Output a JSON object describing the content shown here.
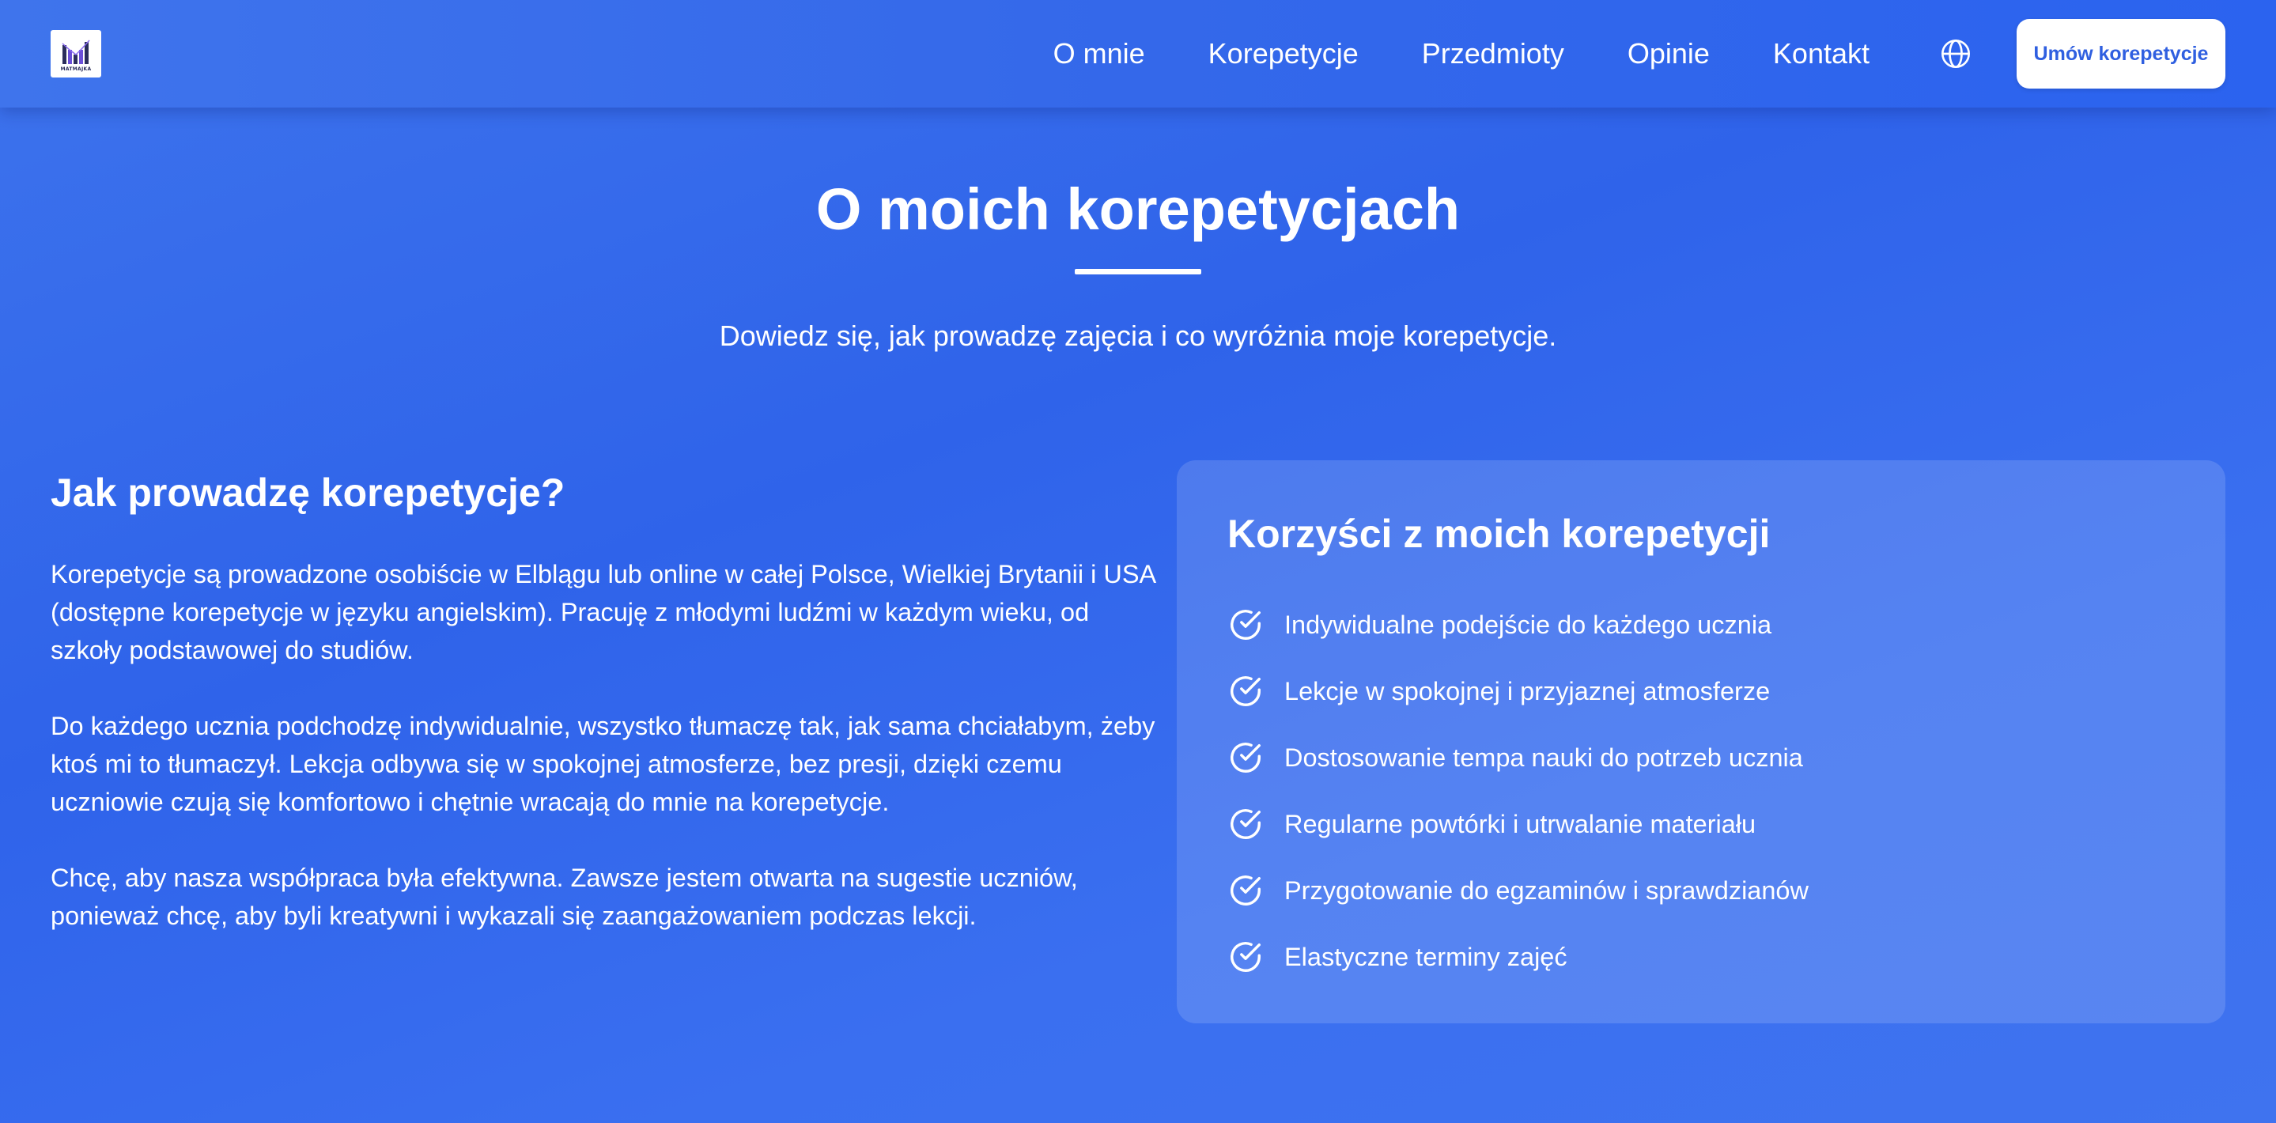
{
  "header": {
    "logo_text": "MATMAJKA",
    "nav": [
      {
        "label": "O mnie"
      },
      {
        "label": "Korepetycje"
      },
      {
        "label": "Przedmioty"
      },
      {
        "label": "Opinie"
      },
      {
        "label": "Kontakt"
      }
    ],
    "language_icon": "globe-icon",
    "cta_label": "Umów korepetycje"
  },
  "hero": {
    "title": "O moich korepetycjach",
    "subtitle": "Dowiedz się, jak prowadzę zajęcia i co wyróżnia moje korepetycje."
  },
  "how": {
    "heading": "Jak prowadzę korepetycje?",
    "paragraphs": [
      "Korepetycje są prowadzone osobiście w Elblągu lub online w całej Polsce, Wielkiej Brytanii i USA (dostępne korepetycje w języku angielskim). Pracuję z młodymi ludźmi w każdym wieku, od szkoły podstawowej do studiów.",
      "Do każdego ucznia podchodzę indywidualnie, wszystko tłumaczę tak, jak sama chciałabym, żeby ktoś mi to tłumaczył. Lekcja odbywa się w spokojnej atmosferze, bez presji, dzięki czemu uczniowie czują się komfortowo i chętnie wracają do mnie na korepetycje.",
      "Chcę, aby nasza współpraca była efektywna. Zawsze jestem otwarta na sugestie uczniów, ponieważ chcę, aby byli kreatywni i wykazali się zaangażowaniem podczas lekcji."
    ]
  },
  "benefits": {
    "heading": "Korzyści z moich korepetycji",
    "items": [
      {
        "label": "Indywidualne podejście do każdego ucznia",
        "icon": "check-circle-icon"
      },
      {
        "label": "Lekcje w spokojnej i przyjaznej atmosferze",
        "icon": "check-circle-icon"
      },
      {
        "label": "Dostosowanie tempa nauki do potrzeb ucznia",
        "icon": "check-circle-icon"
      },
      {
        "label": "Regularne powtórki i utrwalanie materiału",
        "icon": "check-circle-icon"
      },
      {
        "label": "Przygotowanie do egzaminów i sprawdzianów",
        "icon": "check-circle-icon"
      },
      {
        "label": "Elastyczne terminy zajęć",
        "icon": "check-circle-icon"
      }
    ]
  },
  "colors": {
    "background": "#3468ea",
    "accent_text": "#2f5fe0",
    "white": "#ffffff"
  }
}
